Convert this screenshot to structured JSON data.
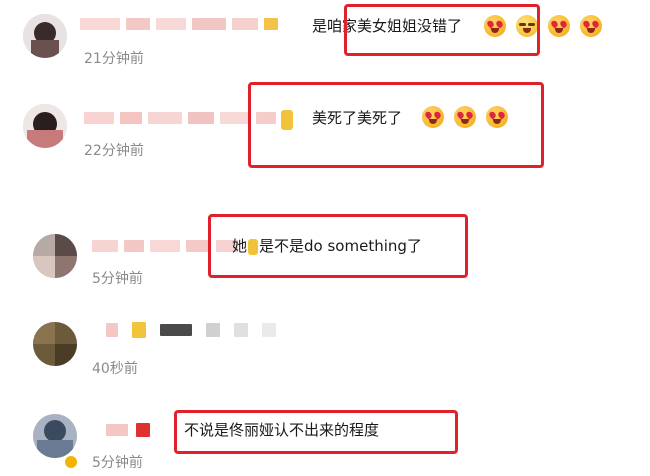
{
  "comments": [
    {
      "text": "是咱家美女姐姐没错了",
      "time": "21分钟前",
      "emojis": [
        "grin-stars-icon",
        "wink-icon",
        "heart-eyes-icon",
        "heart-eyes-icon"
      ]
    },
    {
      "text": "美死了美死了",
      "time": "22分钟前",
      "emojis": [
        "heart-eyes-icon",
        "heart-eyes-icon",
        "heart-eyes-icon"
      ]
    },
    {
      "text_prefix": "她",
      "text_suffix": "是不是do something了",
      "time": "5分钟前"
    },
    {
      "time": "40秒前"
    },
    {
      "text": "不说是佟丽娅认不出来的程度",
      "time": "5分钟前"
    }
  ],
  "highlight_color": "#e0212b"
}
